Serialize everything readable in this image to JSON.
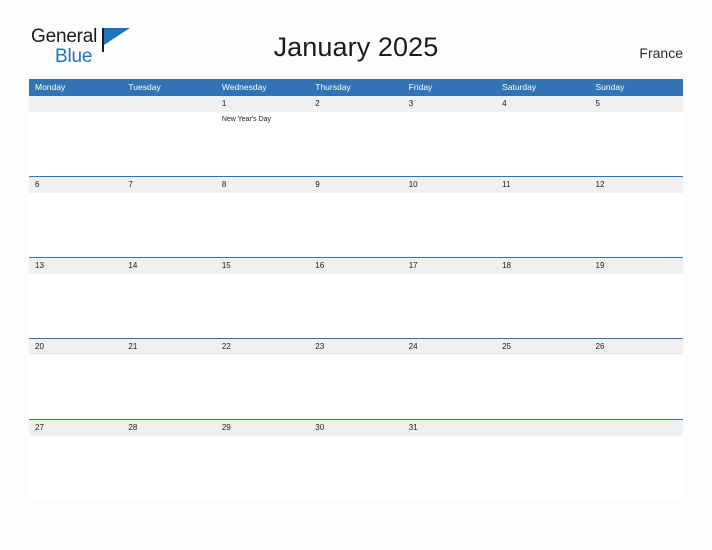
{
  "brand": {
    "name_top": "General",
    "name_bottom": "Blue",
    "color_primary": "#1e74bd",
    "color_text": "#1b1b1b"
  },
  "header": {
    "title": "January 2025",
    "country": "France"
  },
  "calendar": {
    "header_color": "#3173b4",
    "date_band_color": "#f0f0f0",
    "weekdays": [
      "Monday",
      "Tuesday",
      "Wednesday",
      "Thursday",
      "Friday",
      "Saturday",
      "Sunday"
    ],
    "weeks": [
      {
        "days": [
          {
            "date": "",
            "event": ""
          },
          {
            "date": "",
            "event": ""
          },
          {
            "date": "1",
            "event": "New Year's Day"
          },
          {
            "date": "2",
            "event": ""
          },
          {
            "date": "3",
            "event": ""
          },
          {
            "date": "4",
            "event": ""
          },
          {
            "date": "5",
            "event": ""
          }
        ]
      },
      {
        "days": [
          {
            "date": "6",
            "event": ""
          },
          {
            "date": "7",
            "event": ""
          },
          {
            "date": "8",
            "event": ""
          },
          {
            "date": "9",
            "event": ""
          },
          {
            "date": "10",
            "event": ""
          },
          {
            "date": "11",
            "event": ""
          },
          {
            "date": "12",
            "event": ""
          }
        ]
      },
      {
        "days": [
          {
            "date": "13",
            "event": ""
          },
          {
            "date": "14",
            "event": ""
          },
          {
            "date": "15",
            "event": ""
          },
          {
            "date": "16",
            "event": ""
          },
          {
            "date": "17",
            "event": ""
          },
          {
            "date": "18",
            "event": ""
          },
          {
            "date": "19",
            "event": ""
          }
        ]
      },
      {
        "days": [
          {
            "date": "20",
            "event": ""
          },
          {
            "date": "21",
            "event": ""
          },
          {
            "date": "22",
            "event": ""
          },
          {
            "date": "23",
            "event": ""
          },
          {
            "date": "24",
            "event": ""
          },
          {
            "date": "25",
            "event": ""
          },
          {
            "date": "26",
            "event": ""
          }
        ]
      },
      {
        "days": [
          {
            "date": "27",
            "event": ""
          },
          {
            "date": "28",
            "event": ""
          },
          {
            "date": "29",
            "event": ""
          },
          {
            "date": "30",
            "event": ""
          },
          {
            "date": "31",
            "event": ""
          },
          {
            "date": "",
            "event": ""
          },
          {
            "date": "",
            "event": ""
          }
        ]
      }
    ]
  }
}
